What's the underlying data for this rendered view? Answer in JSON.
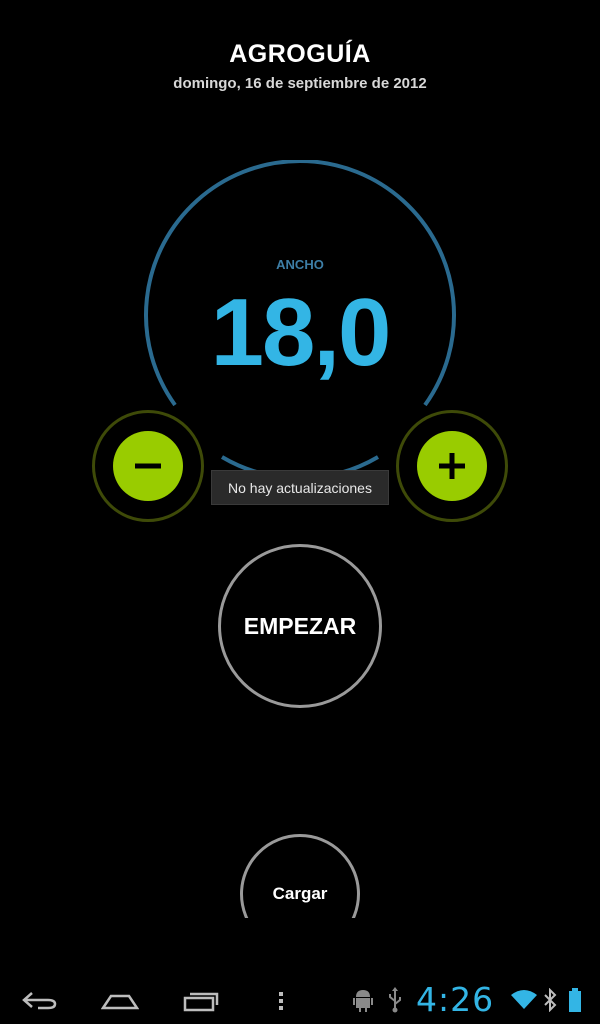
{
  "header": {
    "title": "AGROGUÍA",
    "date": "domingo, 16 de septiembre de 2012"
  },
  "gauge": {
    "label": "ANCHO",
    "value": "18,0",
    "ring_color": "#2a6a8f",
    "value_color": "#33b5e5"
  },
  "stepper": {
    "decrement_icon": "minus-icon",
    "increment_icon": "plus-icon",
    "accent_color": "#99cc00"
  },
  "toast": {
    "message": "No hay actualizaciones"
  },
  "actions": {
    "start_label": "EMPEZAR",
    "load_label": "Cargar"
  },
  "system_bar": {
    "clock": "4:26",
    "nav_icons": [
      "back-icon",
      "home-icon",
      "recent-apps-icon",
      "menu-icon"
    ],
    "status_icons": [
      "android-debug-icon",
      "usb-icon",
      "wifi-icon",
      "bluetooth-icon",
      "battery-icon"
    ],
    "accent_color": "#33b5e5"
  }
}
